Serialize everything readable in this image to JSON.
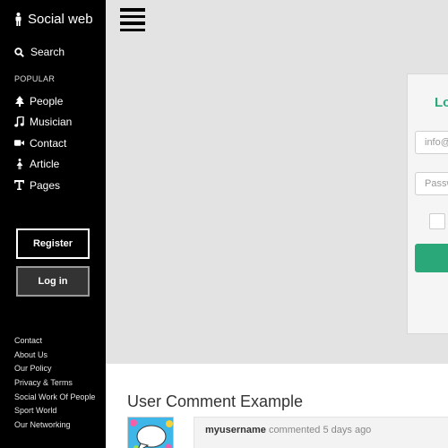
{
  "sidebar": {
    "brand": "Social web",
    "search_label": "Search",
    "section_label": "POPULAR",
    "nav": [
      {
        "label": "People",
        "icon": "tree-icon"
      },
      {
        "label": "Musician",
        "icon": "music-icon"
      },
      {
        "label": "Contact",
        "icon": "video-camera-icon"
      },
      {
        "label": "Article",
        "icon": "female-icon"
      },
      {
        "label": "Pages",
        "icon": "text-icon"
      }
    ],
    "register_label": "Register",
    "login_label": "Log in",
    "footer_links": [
      "Contact",
      "About Us",
      "Our Policy",
      "Privacy & Terms",
      "Social Work Of People",
      "Sport World",
      "Our Networking"
    ]
  },
  "login_form": {
    "title": "Lo",
    "email_placeholder": "info@",
    "password_placeholder": "Passw",
    "accent_color": "#2aa87a"
  },
  "comments": {
    "title": "User Comment Example",
    "items": [
      {
        "username": "myusername",
        "action": "commented",
        "time": "5 days ago"
      }
    ]
  }
}
